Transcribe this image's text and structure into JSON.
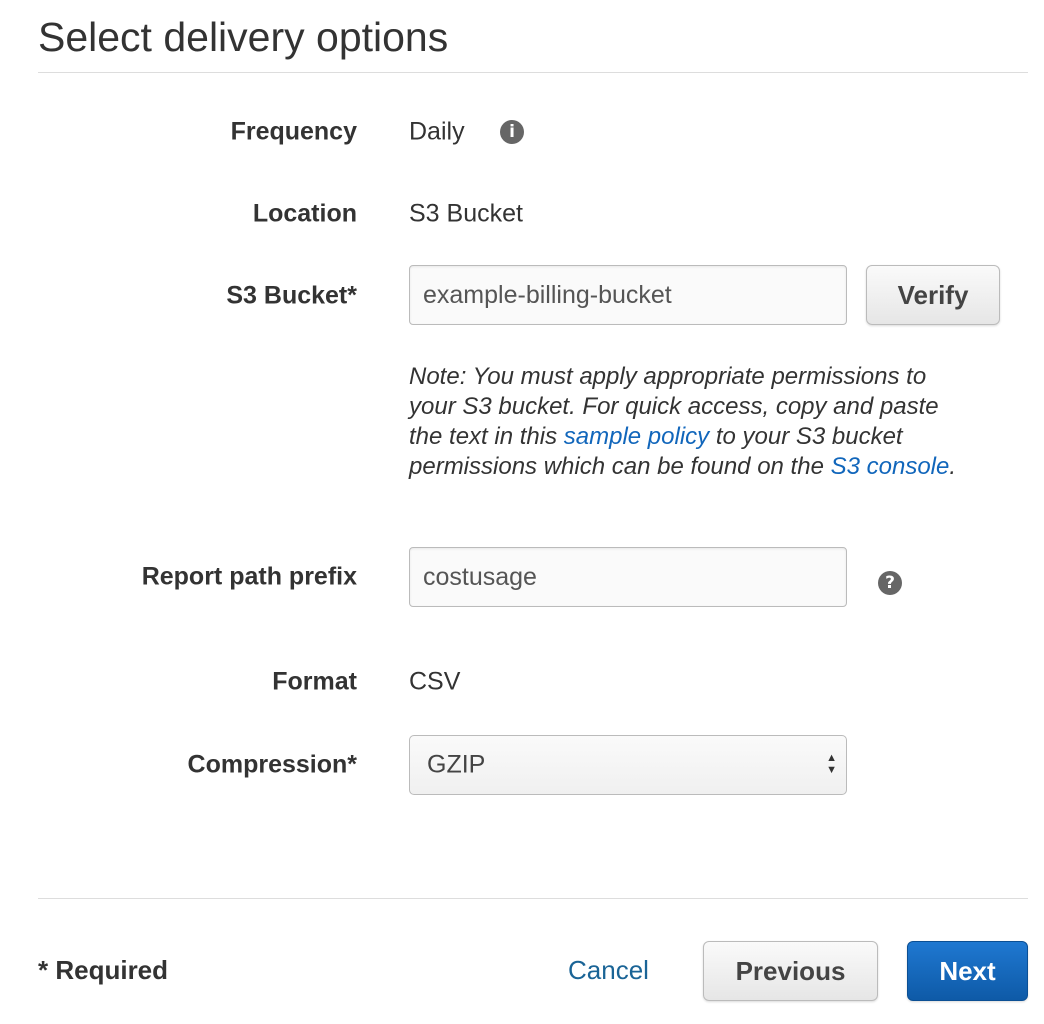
{
  "title": "Select delivery options",
  "fields": {
    "frequency": {
      "label": "Frequency",
      "value": "Daily",
      "icon": "info-icon"
    },
    "location": {
      "label": "Location",
      "value": "S3 Bucket"
    },
    "s3_bucket": {
      "label": "S3 Bucket*",
      "value": "example-billing-bucket",
      "button": "Verify"
    },
    "note": {
      "text1": "Note: You must apply appropriate permissions to your S3 bucket. For quick access, copy and paste the text in this ",
      "link1": "sample policy",
      "text2": " to your S3 bucket permissions which can be found on the ",
      "link2": "S3 console",
      "text3": "."
    },
    "report_path_prefix": {
      "label": "Report path prefix",
      "value": "costusage",
      "icon": "help-icon"
    },
    "format": {
      "label": "Format",
      "value": "CSV"
    },
    "compression": {
      "label": "Compression*",
      "value": "GZIP"
    }
  },
  "footer": {
    "required": "* Required",
    "cancel": "Cancel",
    "previous": "Previous",
    "next": "Next"
  },
  "colors": {
    "link": "#1166bb",
    "primary": "#1f6fc5"
  }
}
